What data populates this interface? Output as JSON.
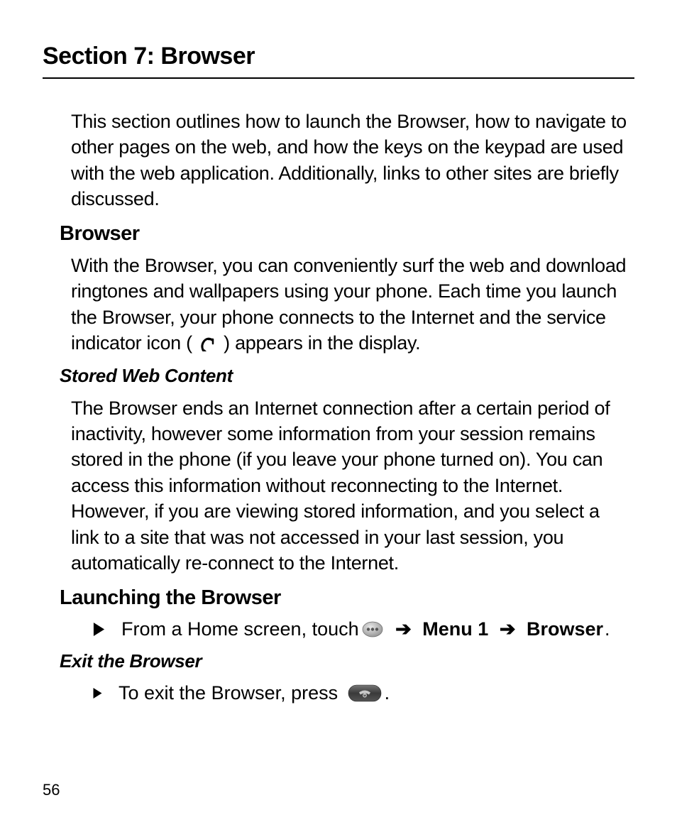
{
  "section_title": "Section 7: Browser",
  "intro_paragraph": "This section outlines how to launch the Browser, how to navigate to other pages on the web, and how the keys on the keypad are used with the web application. Additionally, links to other sites are briefly discussed.",
  "browser": {
    "heading": "Browser",
    "text_before_icon": "With the Browser, you can conveniently surf the web and download ringtones and wallpapers using your phone. Each time you launch the Browser, your phone connects to the Internet and the service indicator icon ( ",
    "text_after_icon": " ) appears in the display."
  },
  "stored_web_content": {
    "heading": "Stored Web Content",
    "text": "The Browser ends an Internet connection after a certain period of inactivity, however some information from your session remains stored in the phone (if you leave your phone turned on). You can access this information without reconnecting to the Internet. However, if you are viewing stored information, and you select a link to a site that was not accessed in your last session, you automatically re-connect to the Internet."
  },
  "launching": {
    "heading": "Launching the Browser",
    "bullet": {
      "prefix": "From a Home screen, touch ",
      "arrow": "➔",
      "menu1": "Menu 1",
      "browser": "Browser",
      "period": "."
    }
  },
  "exit": {
    "heading": "Exit the Browser",
    "bullet": {
      "prefix": "To exit the Browser, press ",
      "period": "."
    }
  },
  "page_number": "56"
}
